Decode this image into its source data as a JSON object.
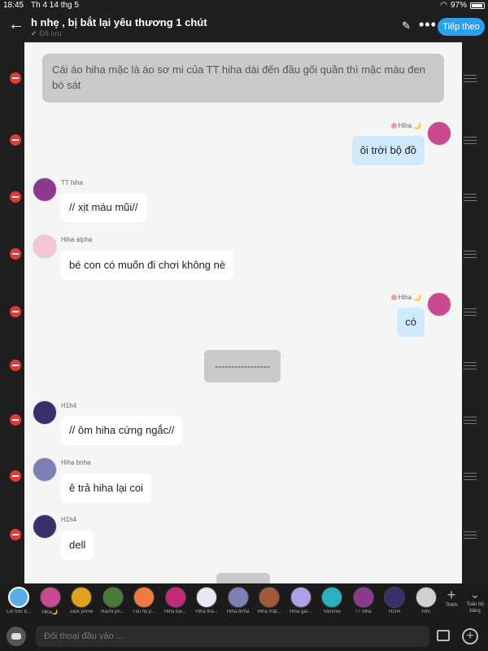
{
  "status_bar": {
    "time": "18:45",
    "date": "Th 4 14 thg 5",
    "battery": "97%"
  },
  "header": {
    "title": "h nhẹ , bị bắt lại yêu thương 1 chút",
    "subtitle": "Đã lưu",
    "next_button": "Tiếp theo"
  },
  "messages": [
    {
      "kind": "narration",
      "text": "Cái áo hiha mặc là áo sơ mi của TT hiha  dài đến đầu gối quần thì mặc màu đen bó sát"
    },
    {
      "kind": "mine",
      "name": "Hiha",
      "text": "ôi trời bộ đồ"
    },
    {
      "kind": "other",
      "name": "TT hiha",
      "text": "// xịt máu mũi//",
      "avatar_color": "#8b3a8f"
    },
    {
      "kind": "other",
      "name": "Hiha alpha",
      "text": "bé con có muốn đi chơi không nè",
      "avatar_color": "#f3c6d6"
    },
    {
      "kind": "mine",
      "name": "Hiha",
      "text": "có"
    },
    {
      "kind": "divider",
      "text": "-----------------"
    },
    {
      "kind": "other",
      "name": "H1h4",
      "text": "// ôm hiha cứng ngắc//",
      "avatar_color": "#3a2f6b"
    },
    {
      "kind": "other",
      "name": "Hiha bnha",
      "text": "ê trả hiha lại coi",
      "avatar_color": "#7d7fb5"
    },
    {
      "kind": "other",
      "name": "H1h4",
      "text": "dell",
      "avatar_color": "#3a2f6b"
    }
  ],
  "character_bar": {
    "chips": [
      {
        "label": "Lời bộc b...",
        "color": "#5aaee8",
        "selected": true
      },
      {
        "label": "Hiha🌙",
        "color": "#c94a8f"
      },
      {
        "label": "Jack prime",
        "color": "#e0a020"
      },
      {
        "label": "Hachi pri...",
        "color": "#4a7a3a"
      },
      {
        "label": "Tàu hũ p...",
        "color": "#f07a40"
      },
      {
        "label": "Hiha bại...",
        "color": "#c02a7a"
      },
      {
        "label": "Hiha tha...",
        "color": "#e8e8f0"
      },
      {
        "label": "Hiha bnha",
        "color": "#7d7fb5"
      },
      {
        "label": "Hiha mật...",
        "color": "#a05a3a"
      },
      {
        "label": "Hiha gal...",
        "color": "#b0a0e8"
      },
      {
        "label": "Yammie",
        "color": "#2ab0c0"
      },
      {
        "label": "TT hiha",
        "color": "#8b3a8f"
      },
      {
        "label": "H1h4",
        "color": "#3a2f6b"
      },
      {
        "label": "Hihi",
        "color": "#d0d0d0"
      }
    ],
    "add_label": "Thêm",
    "toggle_label": "Toàn bộ bảng"
  },
  "input_bar": {
    "placeholder": "Đối thoại đầu vào ..."
  }
}
